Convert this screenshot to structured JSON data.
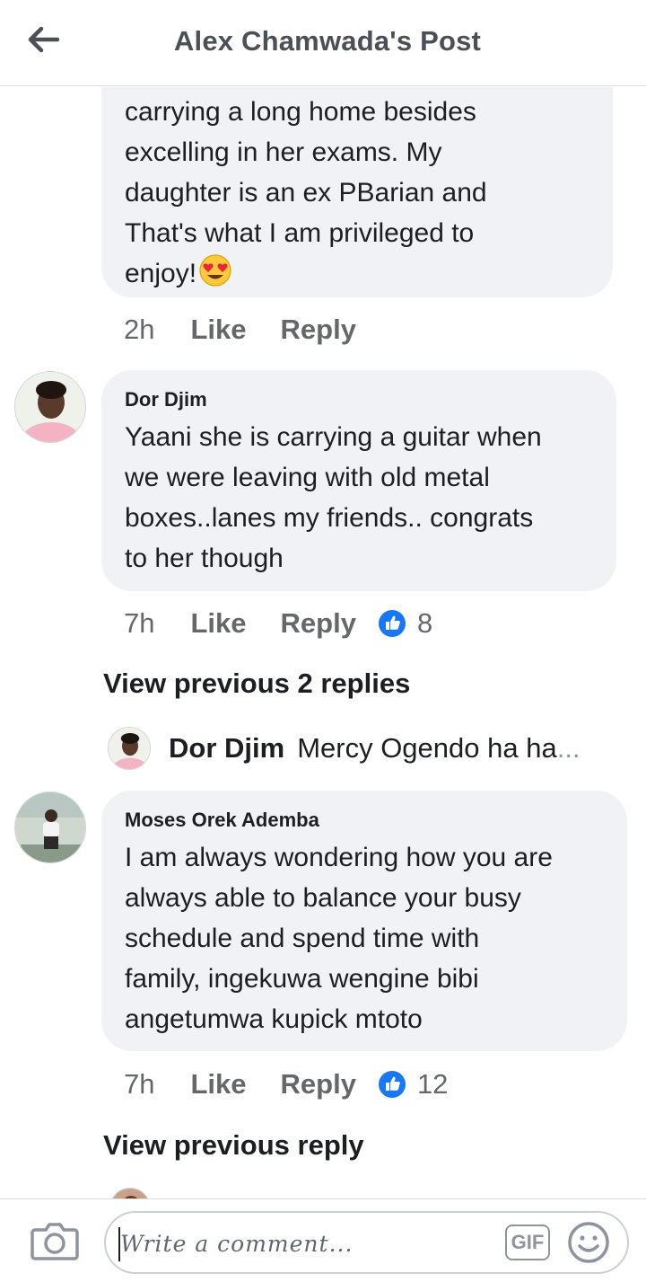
{
  "header": {
    "title": "Alex Chamwada's Post",
    "back_icon": "arrow-left-icon"
  },
  "comments": [
    {
      "author": "",
      "text_lines": [
        "carrying a long home besides",
        "excelling in her exams. My",
        "daughter is an ex PBarian and",
        "That's what I am privileged to",
        "enjoy!"
      ],
      "emoji": "heart-eyes-emoji",
      "time": "2h",
      "like": "Like",
      "reply": "Reply"
    },
    {
      "author": "Dor Djim",
      "text_lines": [
        "Yaani she is carrying a guitar when",
        "we were leaving with old metal",
        "boxes..lanes my friends.. congrats",
        "to her though"
      ],
      "time": "7h",
      "like": "Like",
      "reply": "Reply",
      "reaction_count": "8"
    },
    {
      "author": "Moses Orek Ademba",
      "text_lines": [
        "I am always wondering how you are",
        "always able to balance your busy",
        "schedule and spend time with",
        "family, ingekuwa wengine bibi",
        "angetumwa kupick mtoto"
      ],
      "time": "7h",
      "like": "Like",
      "reply": "Reply",
      "reaction_count": "12"
    }
  ],
  "view_previous_1": "View previous 2 replies",
  "reply_preview": {
    "author": "Dor Djim",
    "text": "Mercy Ogendo  ha ha",
    "ellipsis": "..."
  },
  "view_previous_2": "View previous reply",
  "composer": {
    "placeholder": "Write a comment...",
    "gif_label": "GIF",
    "camera_icon": "camera-icon",
    "emoji_icon": "smiley-icon"
  },
  "colors": {
    "bubble": "#f0f2f5",
    "like_blue": "#1877f2",
    "meta_gray": "#65676b"
  }
}
